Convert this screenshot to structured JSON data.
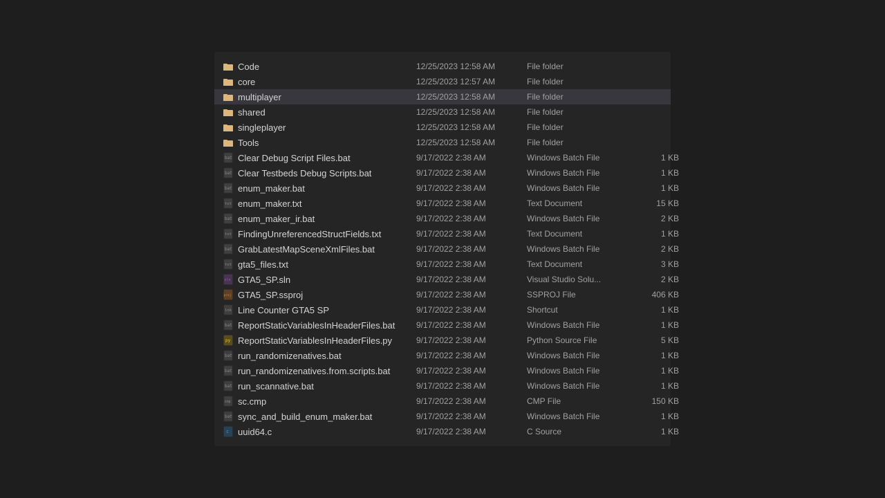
{
  "files": [
    {
      "name": "Code",
      "date": "12/25/2023 12:58 AM",
      "type": "File folder",
      "size": "",
      "icon": "folder",
      "selected": false
    },
    {
      "name": "core",
      "date": "12/25/2023 12:57 AM",
      "type": "File folder",
      "size": "",
      "icon": "folder",
      "selected": false
    },
    {
      "name": "multiplayer",
      "date": "12/25/2023 12:58 AM",
      "type": "File folder",
      "size": "",
      "icon": "folder",
      "selected": true
    },
    {
      "name": "shared",
      "date": "12/25/2023 12:58 AM",
      "type": "File folder",
      "size": "",
      "icon": "folder",
      "selected": false
    },
    {
      "name": "singleplayer",
      "date": "12/25/2023 12:58 AM",
      "type": "File folder",
      "size": "",
      "icon": "folder",
      "selected": false
    },
    {
      "name": "Tools",
      "date": "12/25/2023 12:58 AM",
      "type": "File folder",
      "size": "",
      "icon": "folder",
      "selected": false
    },
    {
      "name": "Clear Debug Script Files.bat",
      "date": "9/17/2022 2:38 AM",
      "type": "Windows Batch File",
      "size": "1 KB",
      "icon": "bat",
      "selected": false
    },
    {
      "name": "Clear Testbeds Debug Scripts.bat",
      "date": "9/17/2022 2:38 AM",
      "type": "Windows Batch File",
      "size": "1 KB",
      "icon": "bat",
      "selected": false
    },
    {
      "name": "enum_maker.bat",
      "date": "9/17/2022 2:38 AM",
      "type": "Windows Batch File",
      "size": "1 KB",
      "icon": "bat",
      "selected": false
    },
    {
      "name": "enum_maker.txt",
      "date": "9/17/2022 2:38 AM",
      "type": "Text Document",
      "size": "15 KB",
      "icon": "txt",
      "selected": false
    },
    {
      "name": "enum_maker_ir.bat",
      "date": "9/17/2022 2:38 AM",
      "type": "Windows Batch File",
      "size": "2 KB",
      "icon": "bat",
      "selected": false
    },
    {
      "name": "FindingUnreferencedStructFields.txt",
      "date": "9/17/2022 2:38 AM",
      "type": "Text Document",
      "size": "1 KB",
      "icon": "txt",
      "selected": false
    },
    {
      "name": "GrabLatestMapSceneXmlFiles.bat",
      "date": "9/17/2022 2:38 AM",
      "type": "Windows Batch File",
      "size": "2 KB",
      "icon": "bat",
      "selected": false
    },
    {
      "name": "gta5_files.txt",
      "date": "9/17/2022 2:38 AM",
      "type": "Text Document",
      "size": "3 KB",
      "icon": "txt",
      "selected": false
    },
    {
      "name": "GTA5_SP.sln",
      "date": "9/17/2022 2:38 AM",
      "type": "Visual Studio Solu...",
      "size": "2 KB",
      "icon": "sln",
      "selected": false
    },
    {
      "name": "GTA5_SP.ssproj",
      "date": "9/17/2022 2:38 AM",
      "type": "SSPROJ File",
      "size": "406 KB",
      "icon": "ssproj",
      "selected": false
    },
    {
      "name": "Line Counter GTA5 SP",
      "date": "9/17/2022 2:38 AM",
      "type": "Shortcut",
      "size": "1 KB",
      "icon": "lnk",
      "selected": false
    },
    {
      "name": "ReportStaticVariablesInHeaderFiles.bat",
      "date": "9/17/2022 2:38 AM",
      "type": "Windows Batch File",
      "size": "1 KB",
      "icon": "bat",
      "selected": false
    },
    {
      "name": "ReportStaticVariablesInHeaderFiles.py",
      "date": "9/17/2022 2:38 AM",
      "type": "Python Source File",
      "size": "5 KB",
      "icon": "py",
      "selected": false
    },
    {
      "name": "run_randomizenatives.bat",
      "date": "9/17/2022 2:38 AM",
      "type": "Windows Batch File",
      "size": "1 KB",
      "icon": "bat",
      "selected": false
    },
    {
      "name": "run_randomizenatives.from.scripts.bat",
      "date": "9/17/2022 2:38 AM",
      "type": "Windows Batch File",
      "size": "1 KB",
      "icon": "bat",
      "selected": false
    },
    {
      "name": "run_scannative.bat",
      "date": "9/17/2022 2:38 AM",
      "type": "Windows Batch File",
      "size": "1 KB",
      "icon": "bat",
      "selected": false
    },
    {
      "name": "sc.cmp",
      "date": "9/17/2022 2:38 AM",
      "type": "CMP File",
      "size": "150 KB",
      "icon": "cmp",
      "selected": false
    },
    {
      "name": "sync_and_build_enum_maker.bat",
      "date": "9/17/2022 2:38 AM",
      "type": "Windows Batch File",
      "size": "1 KB",
      "icon": "bat",
      "selected": false
    },
    {
      "name": "uuid64.c",
      "date": "9/17/2022 2:38 AM",
      "type": "C Source",
      "size": "1 KB",
      "icon": "c",
      "selected": false
    }
  ]
}
